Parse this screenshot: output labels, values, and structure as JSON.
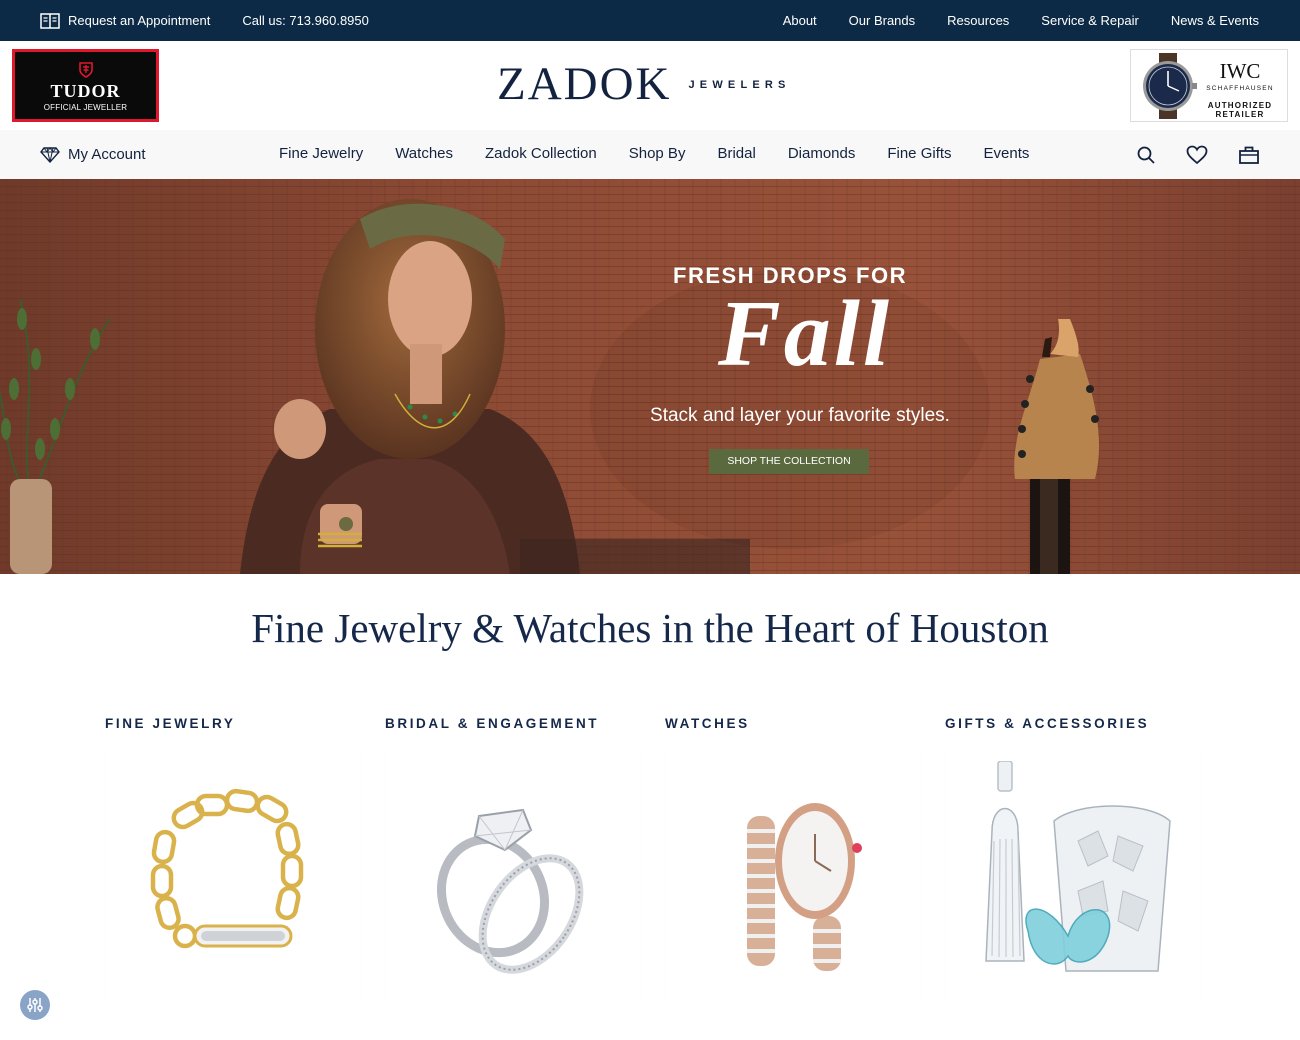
{
  "topbar": {
    "appointment": "Request an Appointment",
    "phone": "Call us: 713.960.8950",
    "links": [
      "About",
      "Our Brands",
      "Resources",
      "Service & Repair",
      "News & Events"
    ]
  },
  "tudor": {
    "brand": "TUDOR",
    "sub": "OFFICIAL JEWELLER"
  },
  "logo": {
    "main": "ZADOK",
    "sub": "JEWELERS"
  },
  "iwc": {
    "brand": "IWC",
    "city": "SCHAFFHAUSEN",
    "line1": "AUTHORIZED",
    "line2": "RETAILER"
  },
  "nav": {
    "account": "My Account",
    "menu": [
      "Fine Jewelry",
      "Watches",
      "Zadok Collection",
      "Shop By",
      "Bridal",
      "Diamonds",
      "Fine Gifts",
      "Events"
    ],
    "icons": [
      "search-icon",
      "heart-icon",
      "bag-icon"
    ]
  },
  "hero": {
    "title1": "FRESH DROPS FOR",
    "title2": "Fall",
    "tagline": "Stack and layer your favorite styles.",
    "button": "SHOP THE COLLECTION"
  },
  "headline": "Fine Jewelry & Watches in the Heart of Houston",
  "categories": [
    {
      "label": "FINE JEWELRY"
    },
    {
      "label": "BRIDAL & ENGAGEMENT"
    },
    {
      "label": "WATCHES"
    },
    {
      "label": "GIFTS & ACCESSORIES"
    }
  ],
  "colors": {
    "topbar": "#0c2a45",
    "navy": "#15284a",
    "hero_button": "#5b6a3e",
    "tudor_red": "#e0182d"
  }
}
